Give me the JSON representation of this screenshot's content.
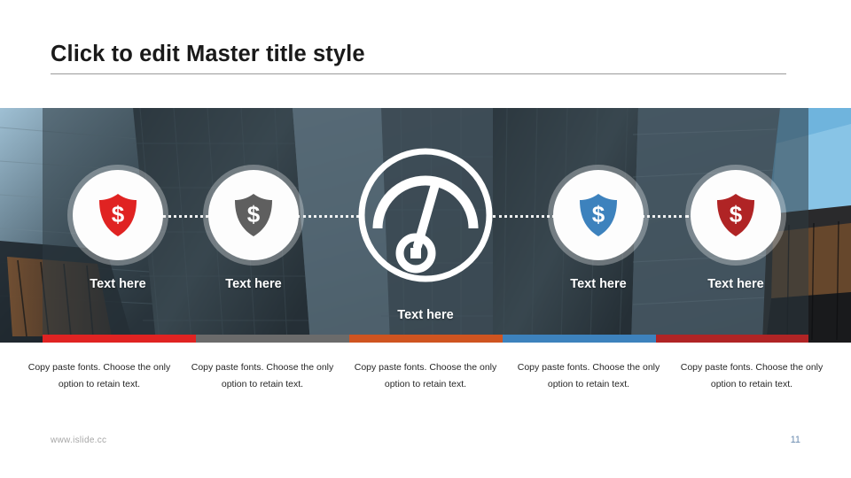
{
  "slide": {
    "title": "Click to edit Master title style",
    "footer_url": "www.islide.cc",
    "page_number": "11"
  },
  "center": {
    "icon": "gauge-icon",
    "label": "Text here"
  },
  "nodes": [
    {
      "icon": "shield-dollar-icon",
      "color": "#e02322",
      "label": "Text here"
    },
    {
      "icon": "shield-dollar-icon",
      "color": "#5f5f5f",
      "label": "Text here"
    },
    {
      "icon": "shield-dollar-icon",
      "color": "#3d82bd",
      "label": "Text here"
    },
    {
      "icon": "shield-dollar-icon",
      "color": "#b02425",
      "label": "Text here"
    }
  ],
  "colorbar": [
    {
      "color": "#e02322"
    },
    {
      "color": "#6b6b6b"
    },
    {
      "color": "#cf5420"
    },
    {
      "color": "#3d82bd"
    },
    {
      "color": "#b02425"
    }
  ],
  "columns": [
    {
      "text": "Copy paste fonts. Choose the only option to retain text."
    },
    {
      "text": "Copy paste fonts. Choose the only option to retain text."
    },
    {
      "text": "Copy paste fonts. Choose the only option to retain text."
    },
    {
      "text": "Copy paste fonts. Choose the only option to retain text."
    },
    {
      "text": "Copy paste fonts. Choose the only option to retain text."
    }
  ]
}
